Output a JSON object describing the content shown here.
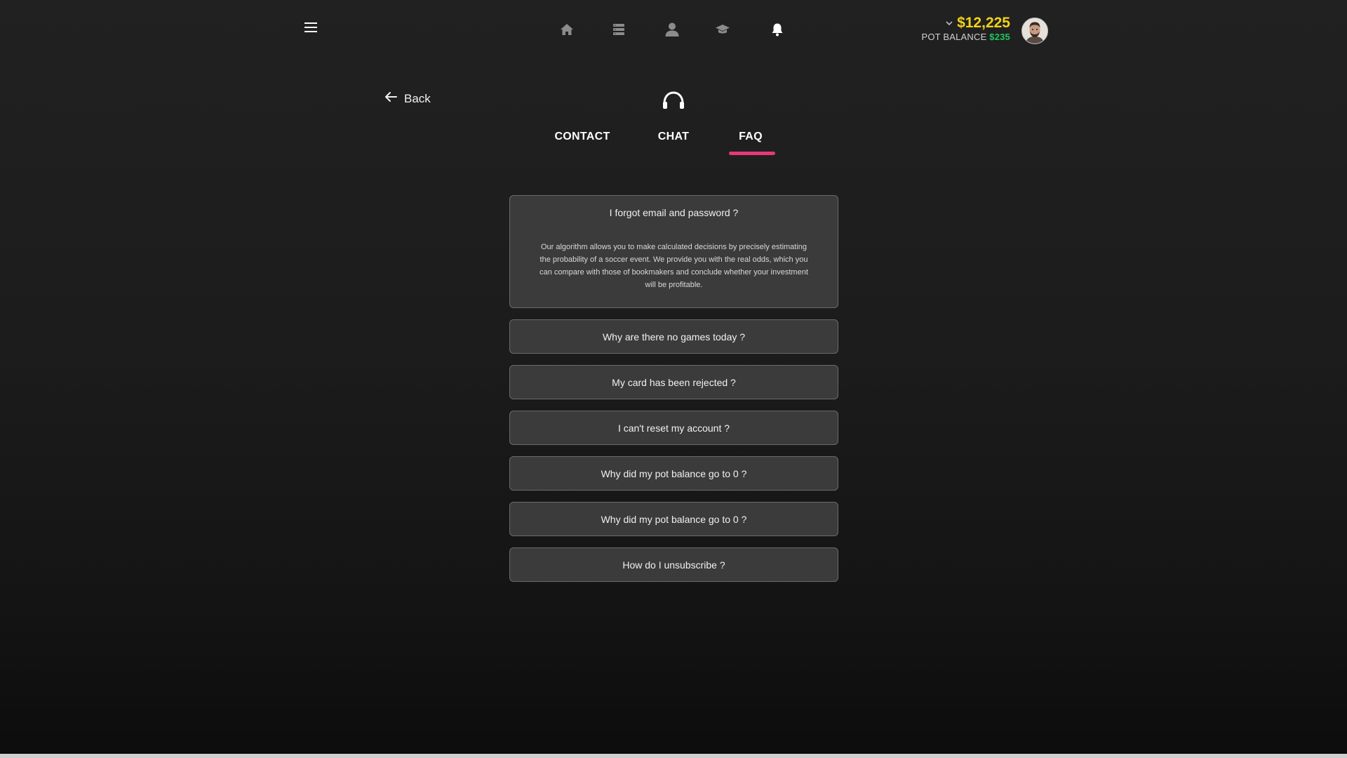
{
  "header": {
    "menu_icon": "hamburger-menu-icon",
    "nav": [
      {
        "name": "home",
        "icon": "home-icon"
      },
      {
        "name": "list",
        "icon": "list-icon"
      },
      {
        "name": "profile",
        "icon": "user-icon"
      },
      {
        "name": "education",
        "icon": "graduation-cap-icon"
      },
      {
        "name": "notifications",
        "icon": "bell-icon"
      }
    ],
    "balance": "$12,225",
    "pot_label": "POT BALANCE",
    "pot_value": "$235",
    "avatar_icon": "avatar"
  },
  "back_label": "Back",
  "tabs": [
    {
      "label": "CONTACT",
      "active": false
    },
    {
      "label": "CHAT",
      "active": false
    },
    {
      "label": "FAQ",
      "active": true
    }
  ],
  "faq": [
    {
      "question": "I forgot email and password ?",
      "answer": "Our algorithm allows you to make calculated decisions by precisely estimating the probability of a soccer event. We provide you with the real odds, which you can compare with those of bookmakers and conclude whether your investment will be profitable.",
      "expanded": true
    },
    {
      "question": "Why are there no games today ?",
      "expanded": false
    },
    {
      "question": "My card has been rejected ?",
      "expanded": false
    },
    {
      "question": "I can't reset my account ?",
      "expanded": false
    },
    {
      "question": "Why did my pot balance go to 0 ?",
      "expanded": false
    },
    {
      "question": "Why did my pot balance go to 0 ?",
      "expanded": false
    },
    {
      "question": "How do I unsubscribe ?",
      "expanded": false
    }
  ],
  "colors": {
    "accent": "#e5397a",
    "balance": "#f2d21a",
    "pot": "#22c55e",
    "card_bg": "#3b3b3b"
  }
}
